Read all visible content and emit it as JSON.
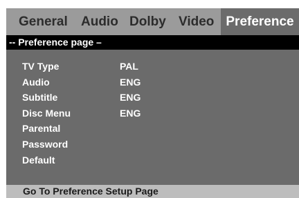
{
  "tabs": [
    {
      "label": "General"
    },
    {
      "label": "Audio"
    },
    {
      "label": "Dolby"
    },
    {
      "label": "Video"
    },
    {
      "label": "Preference",
      "active": true
    }
  ],
  "header": {
    "title": "-- Preference page –"
  },
  "settings": [
    {
      "label": "TV Type",
      "value": "PAL"
    },
    {
      "label": "Audio",
      "value": "ENG"
    },
    {
      "label": "Subtitle",
      "value": "ENG"
    },
    {
      "label": "Disc Menu",
      "value": "ENG"
    },
    {
      "label": "Parental",
      "value": ""
    },
    {
      "label": "Password",
      "value": ""
    },
    {
      "label": "Default",
      "value": ""
    }
  ],
  "footer": {
    "status": "Go To Preference Setup Page"
  },
  "colors": {
    "tab_bar": "#9b9b9b",
    "panel": "#6b6b6b",
    "header": "#000000",
    "footer": "#bdbdbd",
    "active_text": "#ffffff"
  }
}
